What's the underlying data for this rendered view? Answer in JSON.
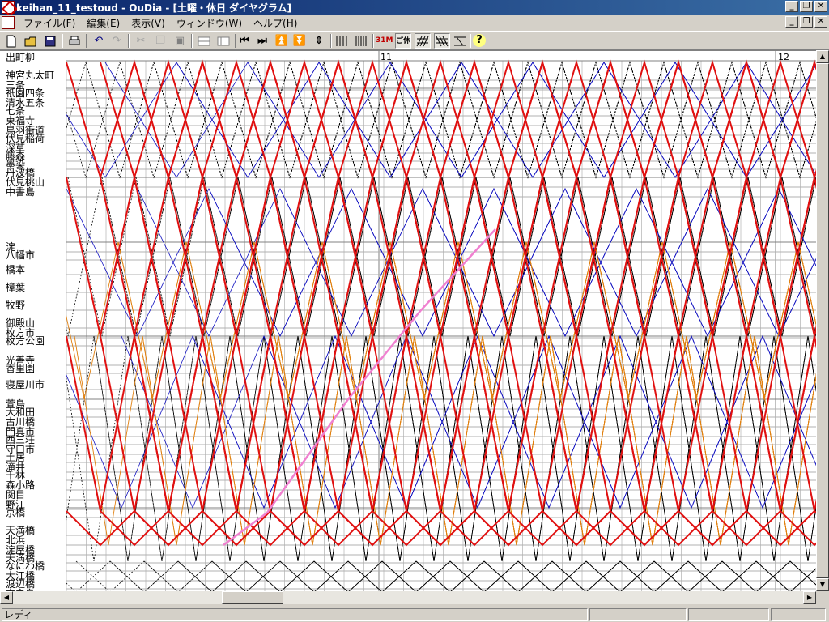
{
  "window": {
    "title": "keihan_11_testoud - OuDia - [土曜・休日 ダイヤグラム]",
    "minimize": "_",
    "restore": "❐",
    "close": "✕"
  },
  "menu": [
    "ファイル(F)",
    "編集(E)",
    "表示(V)",
    "ウィンドウ(W)",
    "ヘルプ(H)"
  ],
  "toolbar": {
    "icons": [
      "new-file-icon",
      "open-folder-icon",
      "save-icon",
      "print-icon",
      "undo-icon",
      "redo-icon",
      "cut-icon",
      "copy-icon",
      "paste-icon",
      "timetable-icon",
      "timetable-alt-icon",
      "first-icon",
      "last-icon",
      "top-icon",
      "bottom-icon",
      "center-icon",
      "vlines-icon"
    ],
    "btn_31m": "31M",
    "btn_ikou": "ご休",
    "help": "?"
  },
  "diagram": {
    "hour_labels": [
      "11",
      "12"
    ],
    "stations": [
      {
        "name": "出町柳"
      },
      {
        "name": "神宮丸太町"
      },
      {
        "name": "三条"
      },
      {
        "name": "祇園四条"
      },
      {
        "name": "清水五条"
      },
      {
        "name": "七条"
      },
      {
        "name": "東福寺"
      },
      {
        "name": "鳥羽街道"
      },
      {
        "name": "伏見稲荷"
      },
      {
        "name": "深草"
      },
      {
        "name": "藤森"
      },
      {
        "name": "墨染"
      },
      {
        "name": "丹波橋"
      },
      {
        "name": "伏見桃山"
      },
      {
        "name": "中書島"
      },
      {
        "name": "淀"
      },
      {
        "name": "八幡市"
      },
      {
        "name": "橋本"
      },
      {
        "name": "樟葉"
      },
      {
        "name": "牧野"
      },
      {
        "name": "御殿山"
      },
      {
        "name": "枚方市"
      },
      {
        "name": "枚方公園"
      },
      {
        "name": "光善寺"
      },
      {
        "name": "香里園"
      },
      {
        "name": "寝屋川市"
      },
      {
        "name": "萱島"
      },
      {
        "name": "大和田"
      },
      {
        "name": "古川橋"
      },
      {
        "name": "門真市"
      },
      {
        "name": "西三荘"
      },
      {
        "name": "守口市"
      },
      {
        "name": "土居"
      },
      {
        "name": "滝井"
      },
      {
        "name": "千林"
      },
      {
        "name": "森小路"
      },
      {
        "name": "関目"
      },
      {
        "name": "野江"
      },
      {
        "name": "京橋"
      },
      {
        "name": "天満橋"
      },
      {
        "name": "北浜"
      },
      {
        "name": "淀屋橋"
      },
      {
        "name": "天満橋"
      },
      {
        "name": "なにわ橋"
      },
      {
        "name": "大江橋"
      },
      {
        "name": "渡辺橋"
      },
      {
        "name": "中之島"
      }
    ]
  },
  "colors": {
    "limited_express": "#e01010",
    "express": "#e08010",
    "local": "#1010c0",
    "semi": "#000000",
    "special": "#f080d0"
  },
  "status": {
    "text": "レディ"
  }
}
